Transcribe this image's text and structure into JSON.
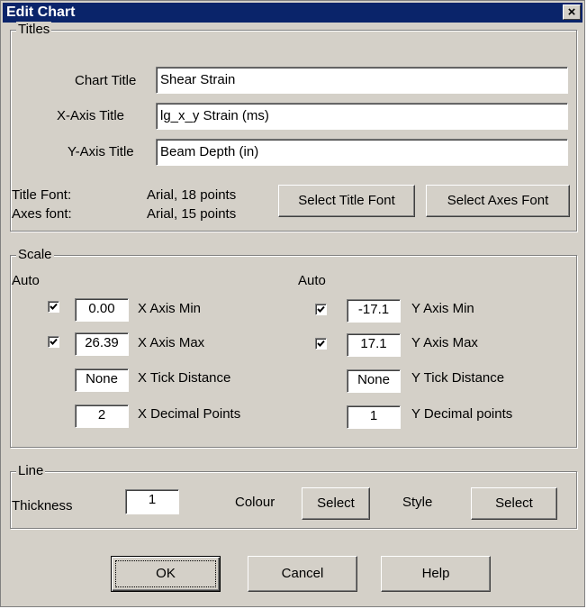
{
  "window": {
    "title": "Edit Chart",
    "close_glyph": "×",
    "close_icon": "close-icon"
  },
  "titles": {
    "legend": "Titles",
    "chart_title_label": "Chart Title",
    "chart_title_value": "Shear Strain",
    "x_axis_title_label": "X-Axis Title",
    "x_axis_title_value": "lg_x_y Strain (ms)",
    "y_axis_title_label": "Y-Axis Title",
    "y_axis_title_value": "Beam Depth (in)",
    "title_font_label": "Title Font:",
    "title_font_value": "Arial, 18 points",
    "axes_font_label": "Axes font:",
    "axes_font_value": "Arial, 15 points",
    "select_title_font_button": "Select Title Font",
    "select_axes_font_button": "Select Axes Font"
  },
  "scale": {
    "legend": "Scale",
    "x_auto_label": "Auto",
    "y_auto_label": "Auto",
    "x_axis_min": {
      "checked": true,
      "value": "0.00",
      "label": "X Axis Min"
    },
    "x_axis_max": {
      "checked": true,
      "value": "26.39",
      "label": "X Axis Max"
    },
    "x_tick_distance": {
      "value": "None",
      "label": "X Tick Distance"
    },
    "x_decimal_points": {
      "value": "2",
      "label": "X Decimal Points"
    },
    "y_axis_min": {
      "checked": true,
      "value": "-17.1",
      "label": "Y Axis Min"
    },
    "y_axis_max": {
      "checked": true,
      "value": "17.1",
      "label": "Y Axis Max"
    },
    "y_tick_distance": {
      "value": "None",
      "label": "Y Tick Distance"
    },
    "y_decimal_points": {
      "value": "1",
      "label": "Y Decimal points"
    }
  },
  "line": {
    "legend": "Line",
    "thickness_label": "Thickness",
    "thickness_value": "1",
    "colour_label": "Colour",
    "colour_button": "Select",
    "style_label": "Style",
    "style_button": "Select"
  },
  "buttons": {
    "ok": "OK",
    "cancel": "Cancel",
    "help": "Help"
  },
  "colors": {
    "title_bar": "#0a246a",
    "dialog_face": "#d4d0c8"
  }
}
